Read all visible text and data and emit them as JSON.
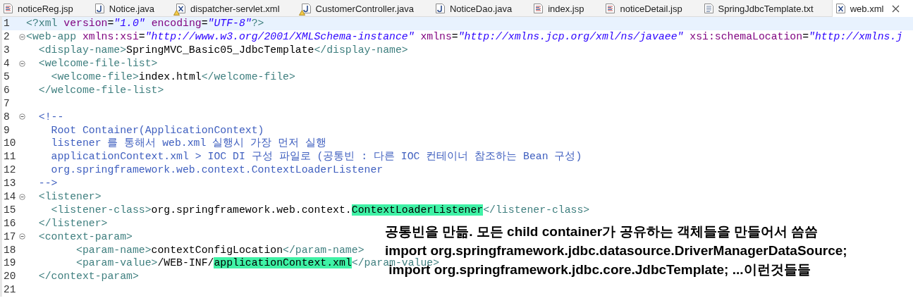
{
  "tabs": [
    {
      "label": "noticeReg.jsp",
      "kind": "jsp",
      "warning": false,
      "selected": false
    },
    {
      "label": "Notice.java",
      "kind": "java",
      "warning": false,
      "selected": false
    },
    {
      "label": "dispatcher-servlet.xml",
      "kind": "xml",
      "warning": true,
      "selected": false
    },
    {
      "label": "CustomerController.java",
      "kind": "java",
      "warning": true,
      "selected": false
    },
    {
      "label": "NoticeDao.java",
      "kind": "java",
      "warning": false,
      "selected": false
    },
    {
      "label": "index.jsp",
      "kind": "jsp",
      "warning": false,
      "selected": false
    },
    {
      "label": "noticeDetail.jsp",
      "kind": "jsp",
      "warning": false,
      "selected": false
    },
    {
      "label": "SpringJdbcTemplate.txt",
      "kind": "txt",
      "warning": false,
      "selected": false
    },
    {
      "label": "web.xml",
      "kind": "xml",
      "warning": false,
      "selected": true
    }
  ],
  "editor": {
    "lines": [
      {
        "number": "1",
        "foldable": false,
        "current": true,
        "tokens": [
          {
            "kind": "tag",
            "text": "<?xml "
          },
          {
            "kind": "attr",
            "text": "version"
          },
          {
            "kind": "text",
            "text": "="
          },
          {
            "kind": "string",
            "text": "\"1.0\" "
          },
          {
            "kind": "attr",
            "text": "encoding"
          },
          {
            "kind": "text",
            "text": "="
          },
          {
            "kind": "string",
            "text": "\"UTF-8\""
          },
          {
            "kind": "tag",
            "text": "?>"
          }
        ]
      },
      {
        "number": "2",
        "foldable": true,
        "current": false,
        "tokens": [
          {
            "kind": "tag",
            "text": "<web-app "
          },
          {
            "kind": "attr",
            "text": "xmlns:xsi"
          },
          {
            "kind": "text",
            "text": "="
          },
          {
            "kind": "string",
            "text": "\"http://www.w3.org/2001/XMLSchema-instance\" "
          },
          {
            "kind": "attr",
            "text": "xmlns"
          },
          {
            "kind": "text",
            "text": "="
          },
          {
            "kind": "string",
            "text": "\"http://xmlns.jcp.org/xml/ns/javaee\" "
          },
          {
            "kind": "attr",
            "text": "xsi:schemaLocation"
          },
          {
            "kind": "text",
            "text": "="
          },
          {
            "kind": "string",
            "text": "\"http://xmlns.j"
          }
        ]
      },
      {
        "number": "3",
        "foldable": false,
        "current": false,
        "tokens": [
          {
            "kind": "tag",
            "text": "  <display-name>"
          },
          {
            "kind": "text",
            "text": "SpringMVC_Basic05_JdbcTemplate"
          },
          {
            "kind": "tag",
            "text": "</display-name>"
          }
        ]
      },
      {
        "number": "4",
        "foldable": true,
        "current": false,
        "tokens": [
          {
            "kind": "tag",
            "text": "  <welcome-file-list>"
          }
        ]
      },
      {
        "number": "5",
        "foldable": false,
        "current": false,
        "tokens": [
          {
            "kind": "tag",
            "text": "    <welcome-file>"
          },
          {
            "kind": "text",
            "text": "index.html"
          },
          {
            "kind": "tag",
            "text": "</welcome-file>"
          }
        ]
      },
      {
        "number": "6",
        "foldable": false,
        "current": false,
        "tokens": [
          {
            "kind": "tag",
            "text": "  </welcome-file-list>"
          }
        ]
      },
      {
        "number": "7",
        "foldable": false,
        "current": false
      },
      {
        "number": "8",
        "foldable": true,
        "current": false,
        "tokens": [
          {
            "kind": "comment",
            "text": "  <!--"
          }
        ]
      },
      {
        "number": "9",
        "foldable": false,
        "current": false,
        "tokens": [
          {
            "kind": "comment",
            "text": "    Root Container(ApplicationContext)"
          }
        ]
      },
      {
        "number": "10",
        "foldable": false,
        "current": false,
        "tokens": [
          {
            "kind": "comment",
            "text": "    listener 를 통해서 web.xml 실행시 가장 먼저 실행"
          }
        ]
      },
      {
        "number": "11",
        "foldable": false,
        "current": false,
        "tokens": [
          {
            "kind": "comment",
            "text": "    applicationContext.xml > IOC DI 구성 파일로 (공통빈 : 다른 IOC 컨테이너 참조하는 Bean 구성)"
          }
        ]
      },
      {
        "number": "12",
        "foldable": false,
        "current": false,
        "tokens": [
          {
            "kind": "comment",
            "text": "    org.springframework.web.context.ContextLoaderListener"
          }
        ]
      },
      {
        "number": "13",
        "foldable": false,
        "current": false,
        "tokens": [
          {
            "kind": "comment",
            "text": "  -->"
          }
        ]
      },
      {
        "number": "14",
        "foldable": true,
        "current": false,
        "tokens": [
          {
            "kind": "tag",
            "text": "  <listener>"
          }
        ]
      },
      {
        "number": "15",
        "foldable": false,
        "current": false,
        "tokens": [
          {
            "kind": "tag",
            "text": "    <listener-class>"
          },
          {
            "kind": "text",
            "text": "org.springframework.web.context."
          },
          {
            "kind": "text",
            "text": "ContextLoaderListener",
            "highlight": true
          },
          {
            "kind": "tag",
            "text": "</listener-class>"
          }
        ]
      },
      {
        "number": "16",
        "foldable": false,
        "current": false,
        "tokens": [
          {
            "kind": "tag",
            "text": "  </listener>"
          }
        ]
      },
      {
        "number": "17",
        "foldable": true,
        "current": false,
        "tokens": [
          {
            "kind": "tag",
            "text": "  <context-param>"
          }
        ]
      },
      {
        "number": "18",
        "foldable": false,
        "current": false,
        "tokens": [
          {
            "kind": "tag",
            "text": "        <param-name>"
          },
          {
            "kind": "text",
            "text": "contextConfigLocation"
          },
          {
            "kind": "tag",
            "text": "</param-name>"
          }
        ]
      },
      {
        "number": "19",
        "foldable": false,
        "current": false,
        "tokens": [
          {
            "kind": "tag",
            "text": "        <param-value>"
          },
          {
            "kind": "text",
            "text": "/WEB-INF/"
          },
          {
            "kind": "text",
            "text": "applicationContext.xml",
            "highlight": true
          },
          {
            "kind": "tag",
            "text": "</param-value>"
          }
        ]
      },
      {
        "number": "20",
        "foldable": false,
        "current": false,
        "tokens": [
          {
            "kind": "tag",
            "text": "  </context-param>"
          }
        ]
      },
      {
        "number": "21",
        "foldable": false,
        "current": false
      }
    ]
  },
  "annotations": [
    "공통빈을 만듦. 모든 child container가 공유하는 객체들을 만들어서 씀씀",
    "import org.springframework.jdbc.datasource.DriverManagerDataSource;",
    " import org.springframework.jdbc.core.JdbcTemplate; ...이런것들들"
  ]
}
